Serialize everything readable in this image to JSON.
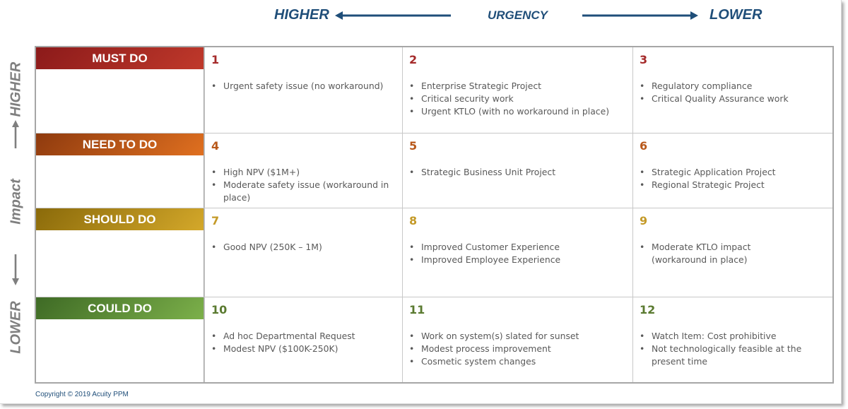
{
  "urgency_axis": {
    "higher_label": "HIGHER",
    "title": "URGENCY",
    "lower_label": "LOWER",
    "color": "#1f4e79"
  },
  "impact_axis": {
    "higher_label": "HIGHER",
    "title": "Impact",
    "lower_label": "LOWER",
    "color": "#7f7f7f"
  },
  "rows": [
    {
      "label": "MUST DO",
      "gradient": [
        "#8b1a1a",
        "#c0392b"
      ],
      "number_color": "#a52a2a",
      "cells": [
        {
          "number": "1",
          "items": [
            "Urgent safety issue (no workaround)"
          ]
        },
        {
          "number": "2",
          "items": [
            "Enterprise Strategic Project",
            "Critical security work",
            "Urgent KTLO (with no workaround in place)"
          ]
        },
        {
          "number": "3",
          "items": [
            "Regulatory compliance",
            "Critical Quality Assurance work"
          ]
        }
      ]
    },
    {
      "label": "NEED TO DO",
      "gradient": [
        "#8e3a0e",
        "#e07020"
      ],
      "number_color": "#b8581a",
      "cells": [
        {
          "number": "4",
          "items": [
            "High NPV ($1M+)",
            "Moderate safety issue (workaround in place)"
          ]
        },
        {
          "number": "5",
          "items": [
            "Strategic Business Unit Project"
          ]
        },
        {
          "number": "6",
          "items": [
            "Strategic Application Project",
            "Regional Strategic Project"
          ]
        }
      ]
    },
    {
      "label": "SHOULD DO",
      "gradient": [
        "#8a6a0a",
        "#d4a82a"
      ],
      "number_color": "#c49a28",
      "cells": [
        {
          "number": "7",
          "items": [
            "Good NPV (250K – 1M)"
          ]
        },
        {
          "number": "8",
          "items": [
            "Improved Customer Experience",
            "Improved Employee Experience"
          ]
        },
        {
          "number": "9",
          "items": [
            "Moderate KTLO impact (workaround in place)"
          ]
        }
      ]
    },
    {
      "label": "COULD DO",
      "gradient": [
        "#3e6a25",
        "#7cb04a"
      ],
      "number_color": "#5a7a30",
      "cells": [
        {
          "number": "10",
          "items": [
            "Ad hoc Departmental Request",
            "Modest NPV ($100K-250K)"
          ]
        },
        {
          "number": "11",
          "items": [
            "Work on system(s) slated for sunset",
            "Modest process improvement",
            "Cosmetic system changes"
          ]
        },
        {
          "number": "12",
          "items": [
            "Watch Item: Cost prohibitive",
            "Not technologically feasible at the present time"
          ]
        }
      ]
    }
  ],
  "copyright": "Copyright © 2019 Acuity PPM"
}
